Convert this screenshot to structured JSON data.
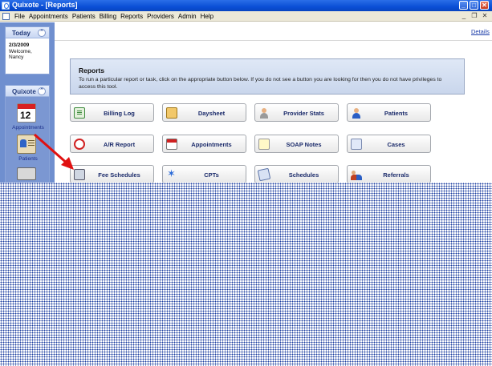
{
  "window": {
    "title": "Quixote - [Reports]",
    "controls": {
      "minimize": "_",
      "maximize": "□",
      "close": "✕"
    }
  },
  "menu": {
    "items": [
      "File",
      "Appointments",
      "Patients",
      "Billing",
      "Reports",
      "Providers",
      "Admin",
      "Help"
    ],
    "mdi_controls": {
      "minimize": "_",
      "restore": "❐",
      "close": "✕"
    }
  },
  "sidebar": {
    "today": {
      "header": "Today",
      "date": "2/3/2009",
      "welcome": "Welcome,",
      "user": "Nancy",
      "collapse_glyph": "⌃"
    },
    "quixote": {
      "header": "Quixote",
      "collapse_glyph": "⌃",
      "calendar_number": "12",
      "items": [
        {
          "label": "Appointments",
          "icon": "calendar-icon"
        },
        {
          "label": "Patients",
          "icon": "patient-card-icon"
        },
        {
          "label": "",
          "icon": "calculator-icon"
        }
      ]
    }
  },
  "main": {
    "details_link": "Details",
    "reports_box": {
      "title": "Reports",
      "description": "To run a particular report or task, click on the appropriate button below.  If you do not see a button you are looking for then you do not have privileges to access this tool."
    },
    "buttons": [
      {
        "label": "Billing Log",
        "icon": "ledger-icon"
      },
      {
        "label": "Daysheet",
        "icon": "clipboard-icon"
      },
      {
        "label": "Provider Stats",
        "icon": "provider-icon"
      },
      {
        "label": "Patients",
        "icon": "patient-icon"
      },
      {
        "label": "A/R Report",
        "icon": "clock-icon"
      },
      {
        "label": "Appointments",
        "icon": "calendar-icon"
      },
      {
        "label": "SOAP Notes",
        "icon": "notes-icon"
      },
      {
        "label": "Cases",
        "icon": "cases-icon"
      },
      {
        "label": "Fee Schedules",
        "icon": "calculator-icon"
      },
      {
        "label": "CPTs",
        "icon": "star-icon"
      },
      {
        "label": "Schedules",
        "icon": "schedule-icon"
      },
      {
        "label": "Referrals",
        "icon": "referrals-icon"
      }
    ]
  },
  "annotation": {
    "arrow_color": "#e01010"
  }
}
